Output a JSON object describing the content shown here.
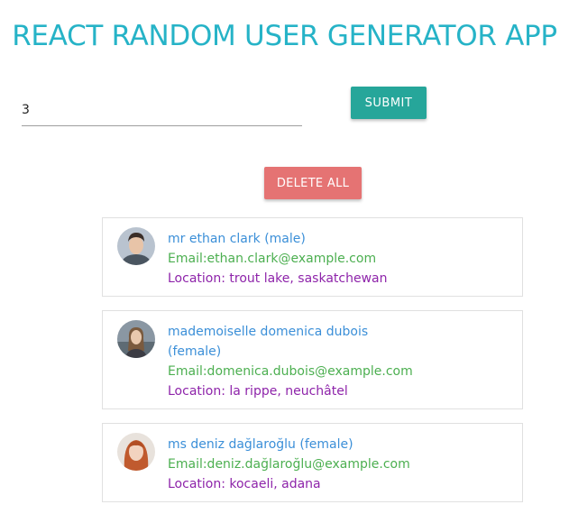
{
  "app": {
    "title": "REACT RANDOM USER GENERATOR APP"
  },
  "form": {
    "count_value": "3",
    "submit_label": "SUBMIT"
  },
  "actions": {
    "delete_all_label": "DELETE ALL"
  },
  "users": [
    {
      "name_line": "mr ethan clark (male)",
      "email_line": "Email:ethan.clark@example.com",
      "location_line": "Location: trout lake, saskatchewan"
    },
    {
      "name_line": "mademoiselle domenica dubois (female)",
      "email_line": "Email:domenica.dubois@example.com",
      "location_line": "Location: la rippe, neuchâtel"
    },
    {
      "name_line": "ms deniz dağlaroğlu (female)",
      "email_line": "Email:deniz.dağlaroğlu@example.com",
      "location_line": "Location: kocaeli, adana"
    }
  ],
  "colors": {
    "title": "#26b3c7",
    "submit_button": "#26a69a",
    "delete_button": "#e57373",
    "name_text": "#3b8fd8",
    "email_text": "#4caf50",
    "location_text": "#8e24aa"
  }
}
